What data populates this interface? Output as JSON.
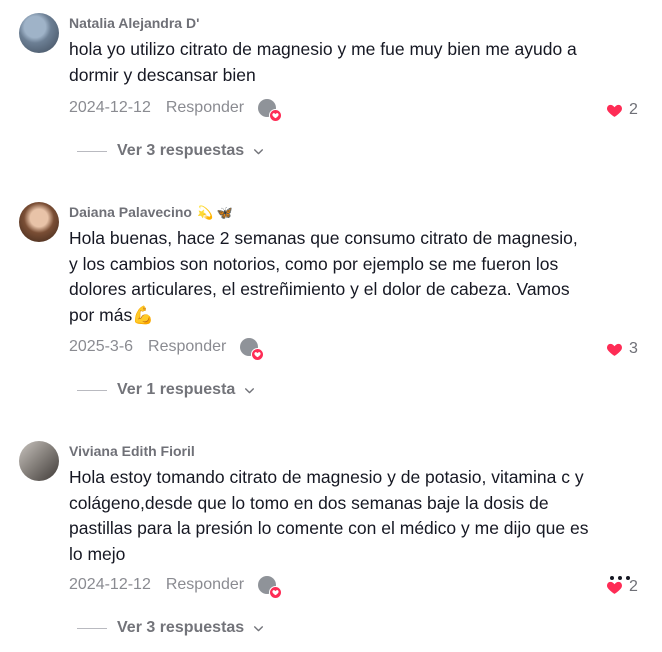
{
  "comments": [
    {
      "username": "Natalia Alejandra D'",
      "emoji": "",
      "text": "hola yo utilizo citrato de magnesio y me fue muy bien me ayudo a dormir y descansar bien",
      "date": "2024-12-12",
      "reply_label": "Responder",
      "likes": "2",
      "view_replies": "Ver 3 respuestas"
    },
    {
      "username": "Daiana Palavecino",
      "emoji": "💫 🦋",
      "text": "Hola buenas, hace 2 semanas que consumo citrato de magnesio, y los cambios son notorios, como por ejemplo se me fueron los dolores articulares, el estreñimiento y el dolor de cabeza. Vamos por más💪",
      "date": "2025-3-6",
      "reply_label": "Responder",
      "likes": "3",
      "view_replies": "Ver 1 respuesta"
    },
    {
      "username": "Viviana Edith Fioril",
      "emoji": "",
      "text": "Hola estoy tomando citrato de magnesio y de potasio, vitamina c y colágeno,desde que lo tomo en dos semanas baje la dosis de pastillas para la presión lo comente con el médico y me dijo que es lo mejo",
      "date": "2024-12-12",
      "reply_label": "Responder",
      "likes": "2",
      "view_replies": "Ver 3 respuestas"
    }
  ],
  "colors": {
    "heart": "#fe2c55",
    "username": "#6f7077",
    "meta": "#8a8b91"
  },
  "icons": {
    "like": "heart-icon",
    "expand": "chevron-down-icon",
    "more": "more-options-icon"
  }
}
